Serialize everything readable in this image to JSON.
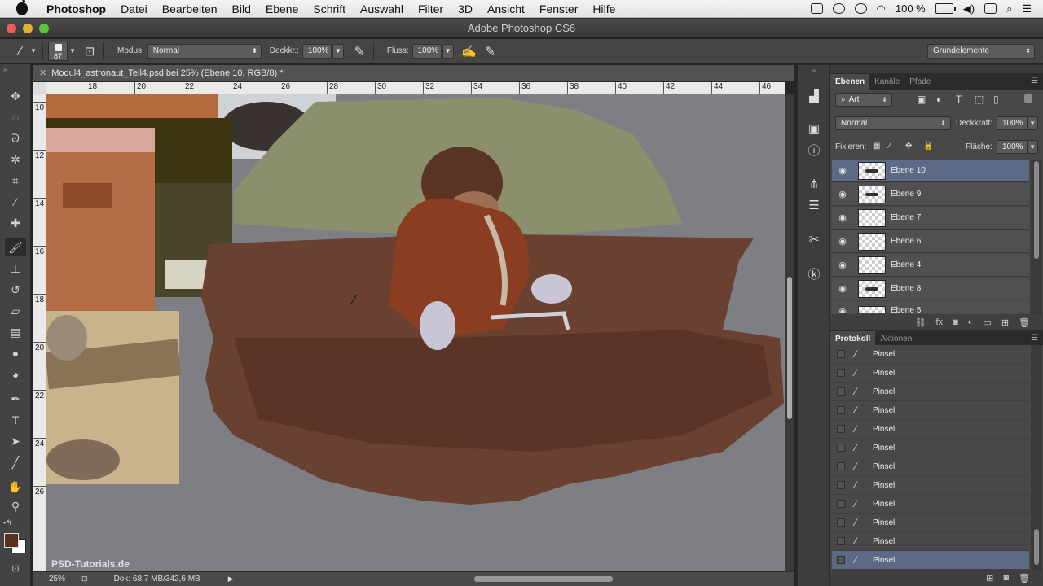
{
  "menubar": {
    "app": "Photoshop",
    "items": [
      "Datei",
      "Bearbeiten",
      "Bild",
      "Ebene",
      "Schrift",
      "Auswahl",
      "Filter",
      "3D",
      "Ansicht",
      "Fenster",
      "Hilfe"
    ],
    "battery": "100 %",
    "status_icons": [
      "adobe-icon",
      "bluetooth-icon",
      "time-machine-icon",
      "wifi-icon",
      "battery-icon",
      "volume-icon",
      "search-icon",
      "list-icon"
    ]
  },
  "window": {
    "title": "Adobe Photoshop CS6"
  },
  "options": {
    "brush_size": "87",
    "modus_label": "Modus:",
    "modus_value": "Normal",
    "deckkraft_label": "Deckkr.:",
    "deckkraft_value": "100%",
    "fluss_label": "Fluss:",
    "fluss_value": "100%",
    "workspace": "Grundelemente"
  },
  "document": {
    "tab": "Modul4_astronaut_Teil4.psd bei 25% (Ebene 10, RGB/8) *",
    "ruler_h": [
      "18",
      "20",
      "22",
      "24",
      "26",
      "28",
      "30",
      "32",
      "34",
      "36",
      "38",
      "40",
      "42",
      "44",
      "46"
    ],
    "ruler_v": [
      "10",
      "12",
      "14",
      "16",
      "18",
      "20",
      "22",
      "24",
      "26"
    ],
    "zoom": "25%",
    "doc_info": "Dok: 68,7 MB/342,6 MB",
    "watermark": "PSD-Tutorials.de"
  },
  "layers_panel": {
    "tabs": [
      "Ebenen",
      "Kanäle",
      "Pfade"
    ],
    "filter": "Art",
    "blend": "Normal",
    "opacity_label": "Deckkraft:",
    "opacity": "100%",
    "lock_label": "Fixieren:",
    "fill_label": "Fläche:",
    "fill": "100%",
    "layers": [
      "Ebene 10",
      "Ebene 9",
      "Ebene 7",
      "Ebene 6",
      "Ebene 4",
      "Ebene 8",
      "Ebene 5"
    ]
  },
  "history_panel": {
    "tabs": [
      "Protokoll",
      "Aktionen"
    ],
    "items": [
      "Pinsel",
      "Pinsel",
      "Pinsel",
      "Pinsel",
      "Pinsel",
      "Pinsel",
      "Pinsel",
      "Pinsel",
      "Pinsel",
      "Pinsel",
      "Pinsel",
      "Pinsel"
    ]
  },
  "colors": {
    "foreground": "#5a3020",
    "background": "#ffffff",
    "selection": "#5c6a85"
  }
}
